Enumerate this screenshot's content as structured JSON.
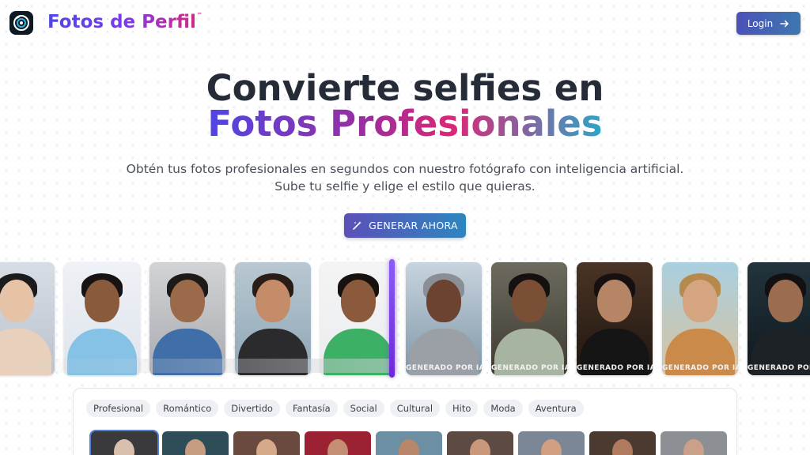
{
  "header": {
    "brand": "Fotos de Perfil",
    "brand_mark": "™",
    "login_label": "Login",
    "logo_icon": "camera-lens-icon",
    "login_icon": "arrow-right-icon"
  },
  "hero": {
    "title_line1": "Convierte selfies en",
    "title_line2": "Fotos Profesionales",
    "subtitle_line1": "Obtén tus fotos profesionales en segundos con nuestro fotógrafo con inteligencia artificial.",
    "subtitle_line2": "Sube tu selfie y elige el estilo que quieras.",
    "cta_label": "GENERAR AHORA",
    "cta_icon": "magic-wand-icon"
  },
  "carousel": {
    "badge_label": "GENERADO POR IA",
    "cards": [
      {
        "kind": "original"
      },
      {
        "kind": "original"
      },
      {
        "kind": "original"
      },
      {
        "kind": "original"
      },
      {
        "kind": "original"
      },
      {
        "kind": "generated"
      },
      {
        "kind": "generated"
      },
      {
        "kind": "generated"
      },
      {
        "kind": "generated"
      },
      {
        "kind": "generated"
      }
    ]
  },
  "styles": {
    "categories": [
      "Profesional",
      "Romántico",
      "Divertido",
      "Fantasía",
      "Social",
      "Cultural",
      "Hito",
      "Moda",
      "Aventura"
    ]
  },
  "colors": {
    "accent_indigo": "#4f46e5",
    "accent_pink": "#db2777",
    "accent_teal": "#2aa6c9",
    "divider_purple": "#7c3aed"
  }
}
